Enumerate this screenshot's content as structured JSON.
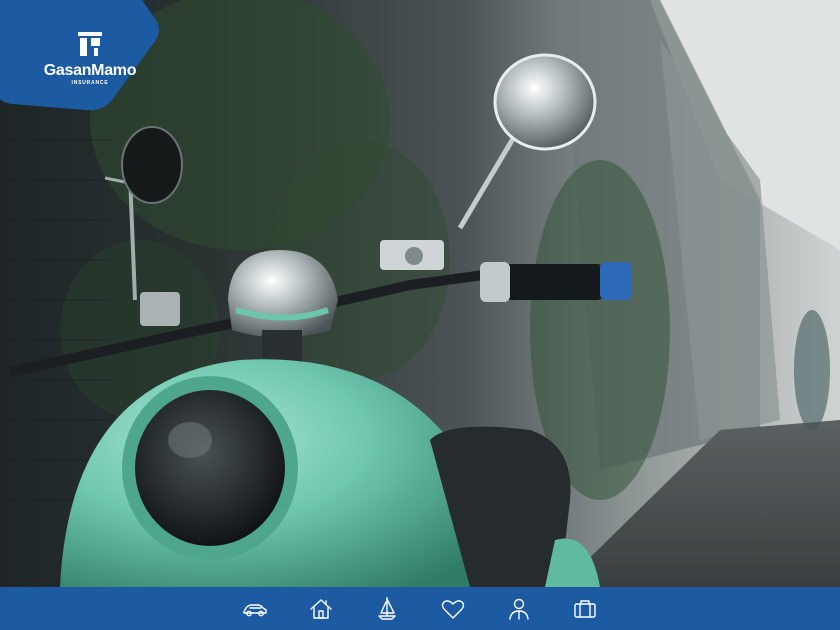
{
  "brand": {
    "name": "GasanMamo",
    "tagline": "INSURANCE",
    "color": "#1c5aa1",
    "logo_icon": "gm-building-mark-icon"
  },
  "hero": {
    "subject": "mint green scooter parked beside ivy-covered brick wall",
    "accent_color": "#6cc6ad"
  },
  "nav": {
    "background": "#1c5aa1",
    "items": [
      {
        "icon": "car-icon",
        "label": "Motor"
      },
      {
        "icon": "home-icon",
        "label": "Home"
      },
      {
        "icon": "sailboat-icon",
        "label": "Marine"
      },
      {
        "icon": "heart-icon",
        "label": "Health"
      },
      {
        "icon": "person-icon",
        "label": "Life"
      },
      {
        "icon": "briefcase-icon",
        "label": "Business"
      }
    ]
  }
}
